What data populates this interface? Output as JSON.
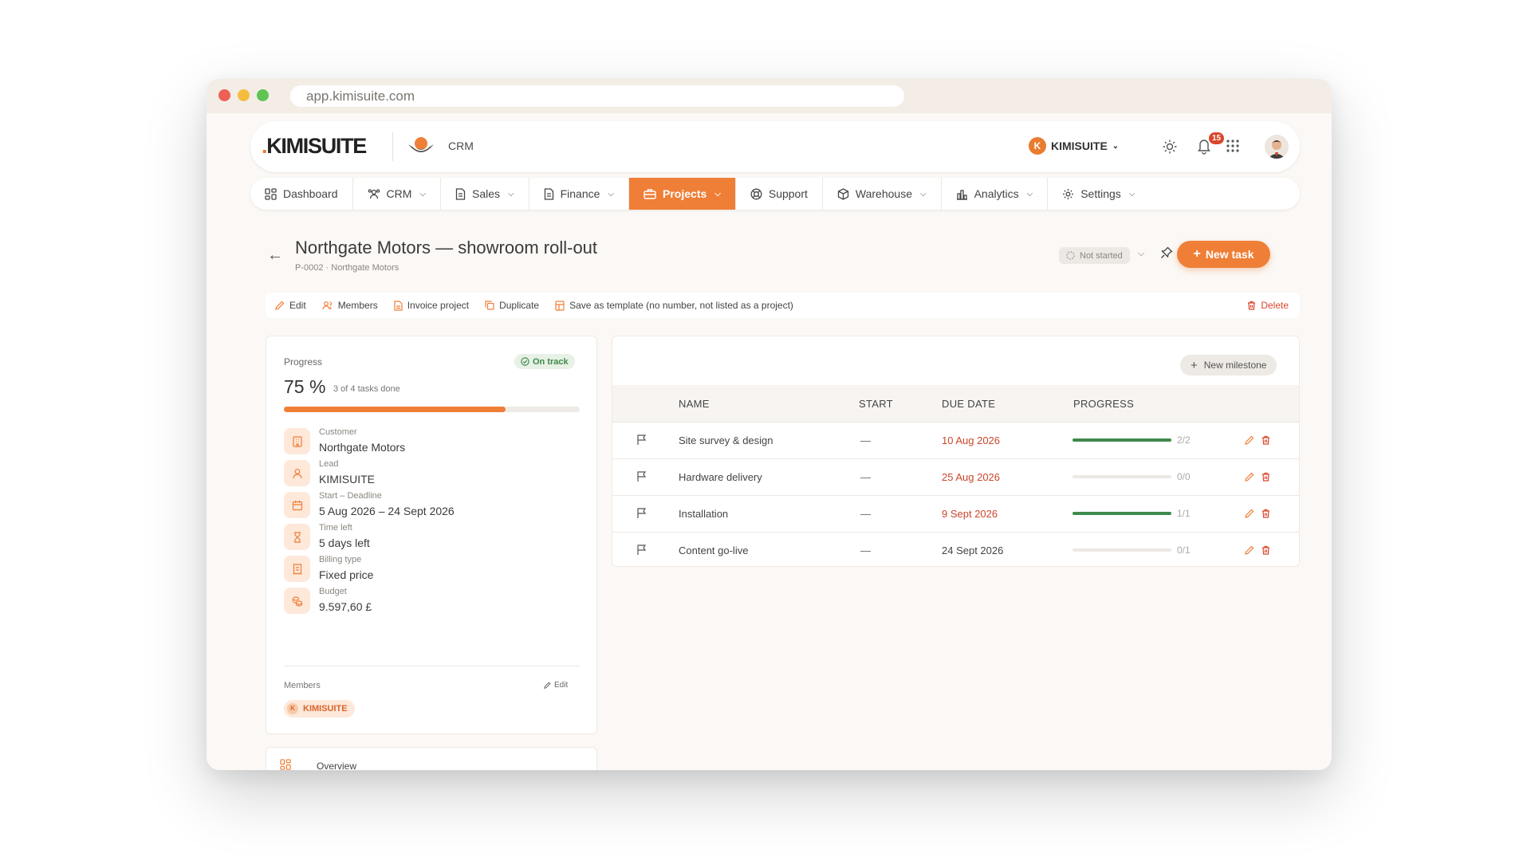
{
  "browser": {
    "url": "app.kimisuite.com"
  },
  "header": {
    "logo_text": "KIMISUITE",
    "app_label": "CRM",
    "org_initial": "K",
    "org_name": "KIMISUITE",
    "notification_count": "15"
  },
  "nav": {
    "items": [
      {
        "label": "Dashboard",
        "icon": "dashboard-icon",
        "has_chevron": false
      },
      {
        "label": "CRM",
        "icon": "users-icon",
        "has_chevron": true
      },
      {
        "label": "Sales",
        "icon": "document-icon",
        "has_chevron": true
      },
      {
        "label": "Finance",
        "icon": "document-icon",
        "has_chevron": true
      },
      {
        "label": "Projects",
        "icon": "briefcase-icon",
        "has_chevron": true,
        "active": true
      },
      {
        "label": "Support",
        "icon": "lifebuoy-icon",
        "has_chevron": false
      },
      {
        "label": "Warehouse",
        "icon": "box-icon",
        "has_chevron": true
      },
      {
        "label": "Analytics",
        "icon": "chart-icon",
        "has_chevron": true
      },
      {
        "label": "Settings",
        "icon": "gear-icon",
        "has_chevron": true
      }
    ]
  },
  "project": {
    "title": "Northgate Motors — showroom roll-out",
    "subtitle": "P-0002 · Northgate Motors",
    "status": "Not started",
    "new_task_label": "New task"
  },
  "actions": {
    "edit": "Edit",
    "members": "Members",
    "invoice": "Invoice project",
    "duplicate": "Duplicate",
    "save_template": "Save as template (no number, not listed as a project)",
    "delete": "Delete"
  },
  "progress": {
    "label": "Progress",
    "status_badge": "On track",
    "percent_text": "75 %",
    "percent_value": 75,
    "tasks_done": "3 of 4 tasks done"
  },
  "details": [
    {
      "label": "Customer",
      "value": "Northgate Motors",
      "icon": "building-icon"
    },
    {
      "label": "Lead",
      "value": "KIMISUITE",
      "icon": "user-icon"
    },
    {
      "label": "Start – Deadline",
      "value": "5 Aug 2026 – 24 Sept 2026",
      "icon": "calendar-icon"
    },
    {
      "label": "Time left",
      "value": "5 days left",
      "icon": "hourglass-icon"
    },
    {
      "label": "Billing type",
      "value": "Fixed price",
      "icon": "receipt-icon"
    },
    {
      "label": "Budget",
      "value": "9.597,60 £",
      "icon": "coins-icon"
    }
  ],
  "members_section": {
    "label": "Members",
    "edit_label": "Edit",
    "member_initial": "K",
    "member_name": "KIMISUITE"
  },
  "overview": {
    "label": "Overview"
  },
  "milestones": {
    "new_label": "New milestone",
    "headers": {
      "name": "NAME",
      "start": "START",
      "due": "DUE DATE",
      "progress": "PROGRESS"
    },
    "rows": [
      {
        "name": "Site survey & design",
        "start": "—",
        "due": "10 Aug 2026",
        "overdue": true,
        "fraction": "2/2",
        "progress": 1.0
      },
      {
        "name": "Hardware delivery",
        "start": "—",
        "due": "25 Aug 2026",
        "overdue": true,
        "fraction": "0/0",
        "progress": 0.0
      },
      {
        "name": "Installation",
        "start": "—",
        "due": "9 Sept 2026",
        "overdue": true,
        "fraction": "1/1",
        "progress": 1.0
      },
      {
        "name": "Content go-live",
        "start": "—",
        "due": "24 Sept 2026",
        "overdue": false,
        "fraction": "0/1",
        "progress": 0.0
      }
    ]
  },
  "colors": {
    "accent": "#ef7f37",
    "success": "#3f8a4c",
    "danger": "#c9472b"
  }
}
